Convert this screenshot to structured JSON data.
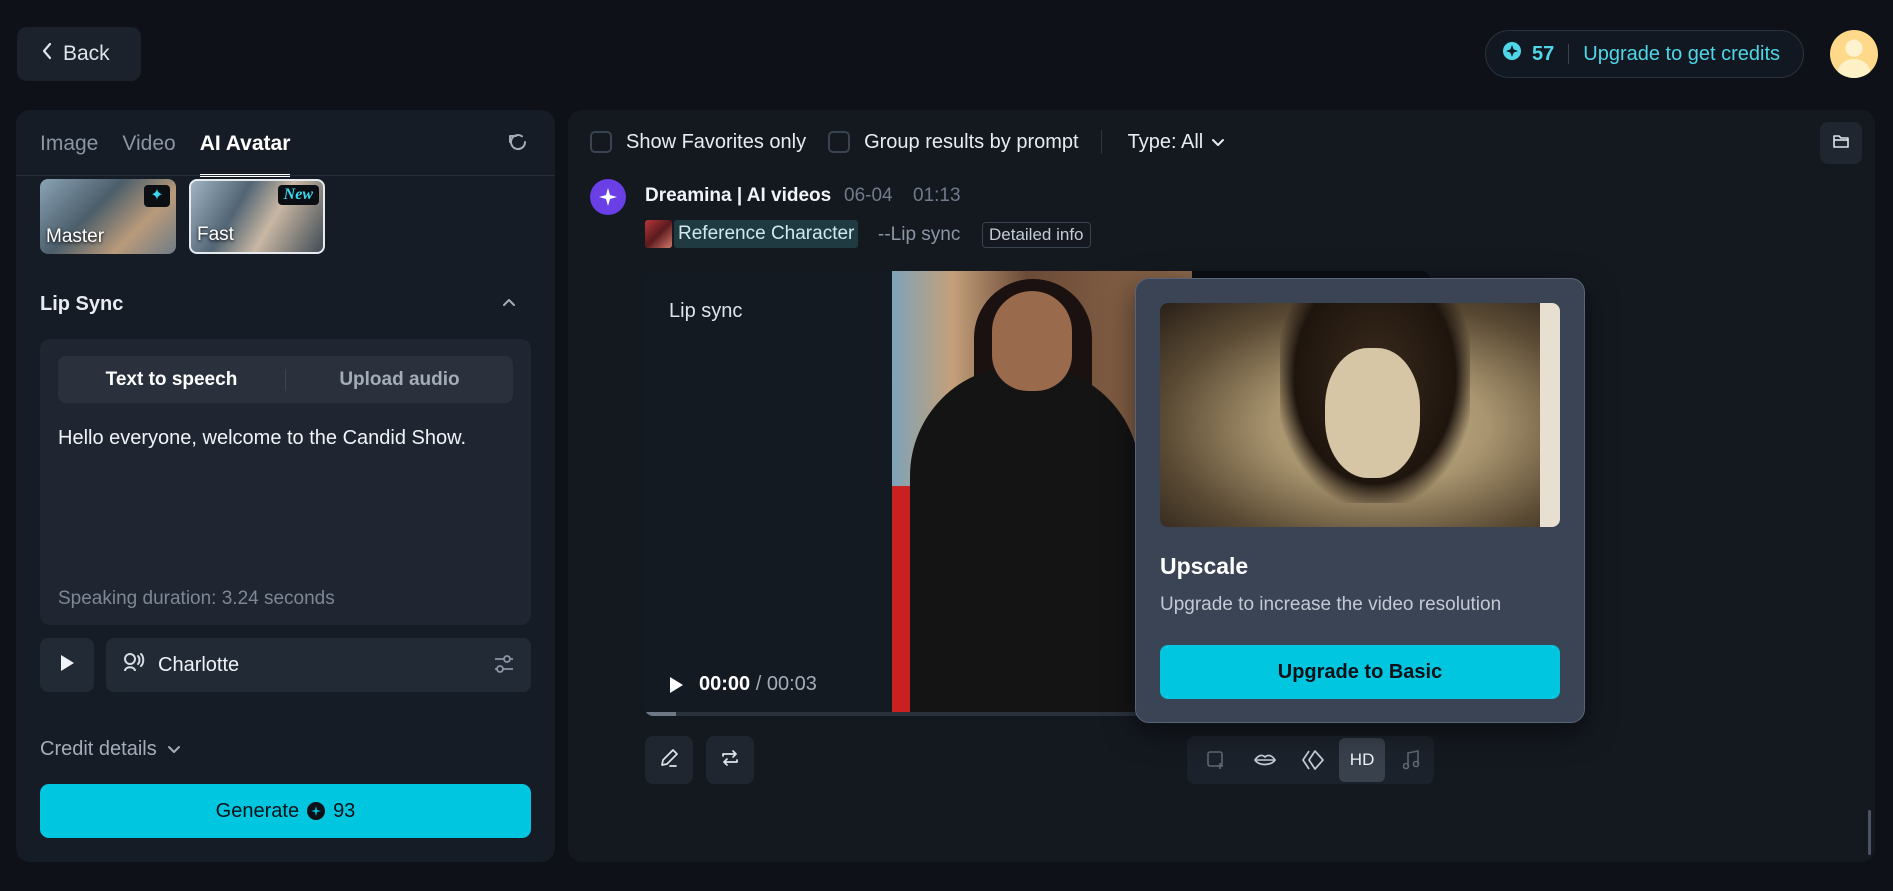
{
  "topbar": {
    "back_label": "Back",
    "credits_count": "57",
    "upgrade_credits_label": "Upgrade to get credits"
  },
  "left": {
    "tabs": [
      {
        "label": "Image"
      },
      {
        "label": "Video"
      },
      {
        "label": "AI Avatar"
      }
    ],
    "models": [
      {
        "label": "Master",
        "badge": "✦"
      },
      {
        "label": "Fast",
        "badge": "New"
      }
    ],
    "lipsync_title": "Lip Sync",
    "segment": {
      "tts": "Text to speech",
      "upload": "Upload audio"
    },
    "speech_text": "Hello everyone, welcome to the Candid Show.",
    "duration": "Speaking duration: 3.24 seconds",
    "voice_name": "Charlotte",
    "credit_details": "Credit details",
    "generate_label": "Generate",
    "generate_cost": "93"
  },
  "right": {
    "filters": {
      "favorites": "Show Favorites only",
      "group": "Group results by prompt",
      "type": "Type: All"
    },
    "entry": {
      "title": "Dreamina | AI videos",
      "date": "06-04",
      "time": "01:13",
      "ref_label": "Reference Character",
      "mode": "--Lip sync",
      "detail": "Detailed info"
    },
    "video": {
      "label": "Lip sync",
      "current": "00:00",
      "sep": " / ",
      "duration": "00:03",
      "progress": 0.04
    },
    "toolbar": {
      "hd_label": "HD"
    }
  },
  "popover": {
    "title": "Upscale",
    "description": "Upgrade to increase the video resolution",
    "button": "Upgrade to Basic"
  },
  "colors": {
    "accent": "#00c7df",
    "background": "#0e1218",
    "panel": "#161c25"
  }
}
